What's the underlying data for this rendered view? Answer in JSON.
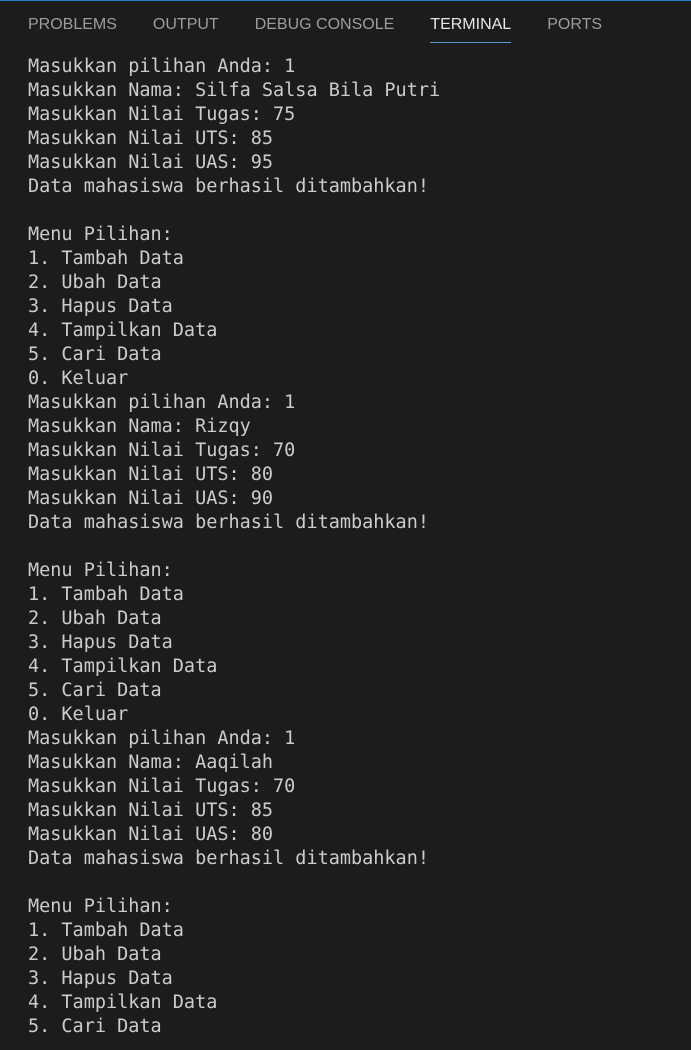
{
  "tabs": [
    {
      "label": "PROBLEMS"
    },
    {
      "label": "OUTPUT"
    },
    {
      "label": "DEBUG CONSOLE"
    },
    {
      "label": "TERMINAL"
    },
    {
      "label": "PORTS"
    }
  ],
  "active_tab": "TERMINAL",
  "terminal": {
    "lines": [
      "Masukkan pilihan Anda: 1",
      "Masukkan Nama: Silfa Salsa Bila Putri",
      "Masukkan Nilai Tugas: 75",
      "Masukkan Nilai UTS: 85",
      "Masukkan Nilai UAS: 95",
      "Data mahasiswa berhasil ditambahkan!",
      "",
      "Menu Pilihan:",
      "1. Tambah Data",
      "2. Ubah Data",
      "3. Hapus Data",
      "4. Tampilkan Data",
      "5. Cari Data",
      "0. Keluar",
      "Masukkan pilihan Anda: 1",
      "Masukkan Nama: Rizqy",
      "Masukkan Nilai Tugas: 70",
      "Masukkan Nilai UTS: 80",
      "Masukkan Nilai UAS: 90",
      "Data mahasiswa berhasil ditambahkan!",
      "",
      "Menu Pilihan:",
      "1. Tambah Data",
      "2. Ubah Data",
      "3. Hapus Data",
      "4. Tampilkan Data",
      "5. Cari Data",
      "0. Keluar",
      "Masukkan pilihan Anda: 1",
      "Masukkan Nama: Aaqilah",
      "Masukkan Nilai Tugas: 70",
      "Masukkan Nilai UTS: 85",
      "Masukkan Nilai UAS: 80",
      "Data mahasiswa berhasil ditambahkan!",
      "",
      "Menu Pilihan:",
      "1. Tambah Data",
      "2. Ubah Data",
      "3. Hapus Data",
      "4. Tampilkan Data",
      "5. Cari Data"
    ]
  }
}
